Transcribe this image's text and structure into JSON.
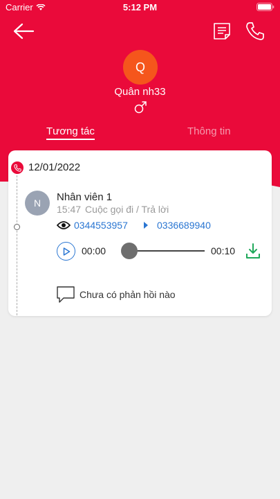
{
  "status_bar": {
    "carrier": "Carrier",
    "time": "5:12 PM"
  },
  "contact": {
    "initial": "Q",
    "name": "Quân nh33"
  },
  "tabs": [
    {
      "label": "Tương tác",
      "active": true
    },
    {
      "label": "Thông tin",
      "active": false
    }
  ],
  "timeline": {
    "date": "12/01/2022",
    "entry": {
      "staff_initial": "N",
      "staff_name": "Nhân viên 1",
      "time": "15:47",
      "call_type": "Cuộc gọi đi / Trả lời",
      "from_number": "0344553957",
      "to_number": "0336689940",
      "player": {
        "current": "00:00",
        "duration": "00:10",
        "progress": 0
      },
      "feedback": "Chưa có phản hồi nào"
    }
  },
  "colors": {
    "brand": "#ea0a3a",
    "avatar": "#f5561c",
    "link": "#2a76d2",
    "download": "#1fa85a"
  },
  "icons": [
    "back-arrow-icon",
    "note-icon",
    "phone-icon",
    "male-icon",
    "eye-icon",
    "play-icon",
    "download-icon",
    "comment-icon"
  ]
}
